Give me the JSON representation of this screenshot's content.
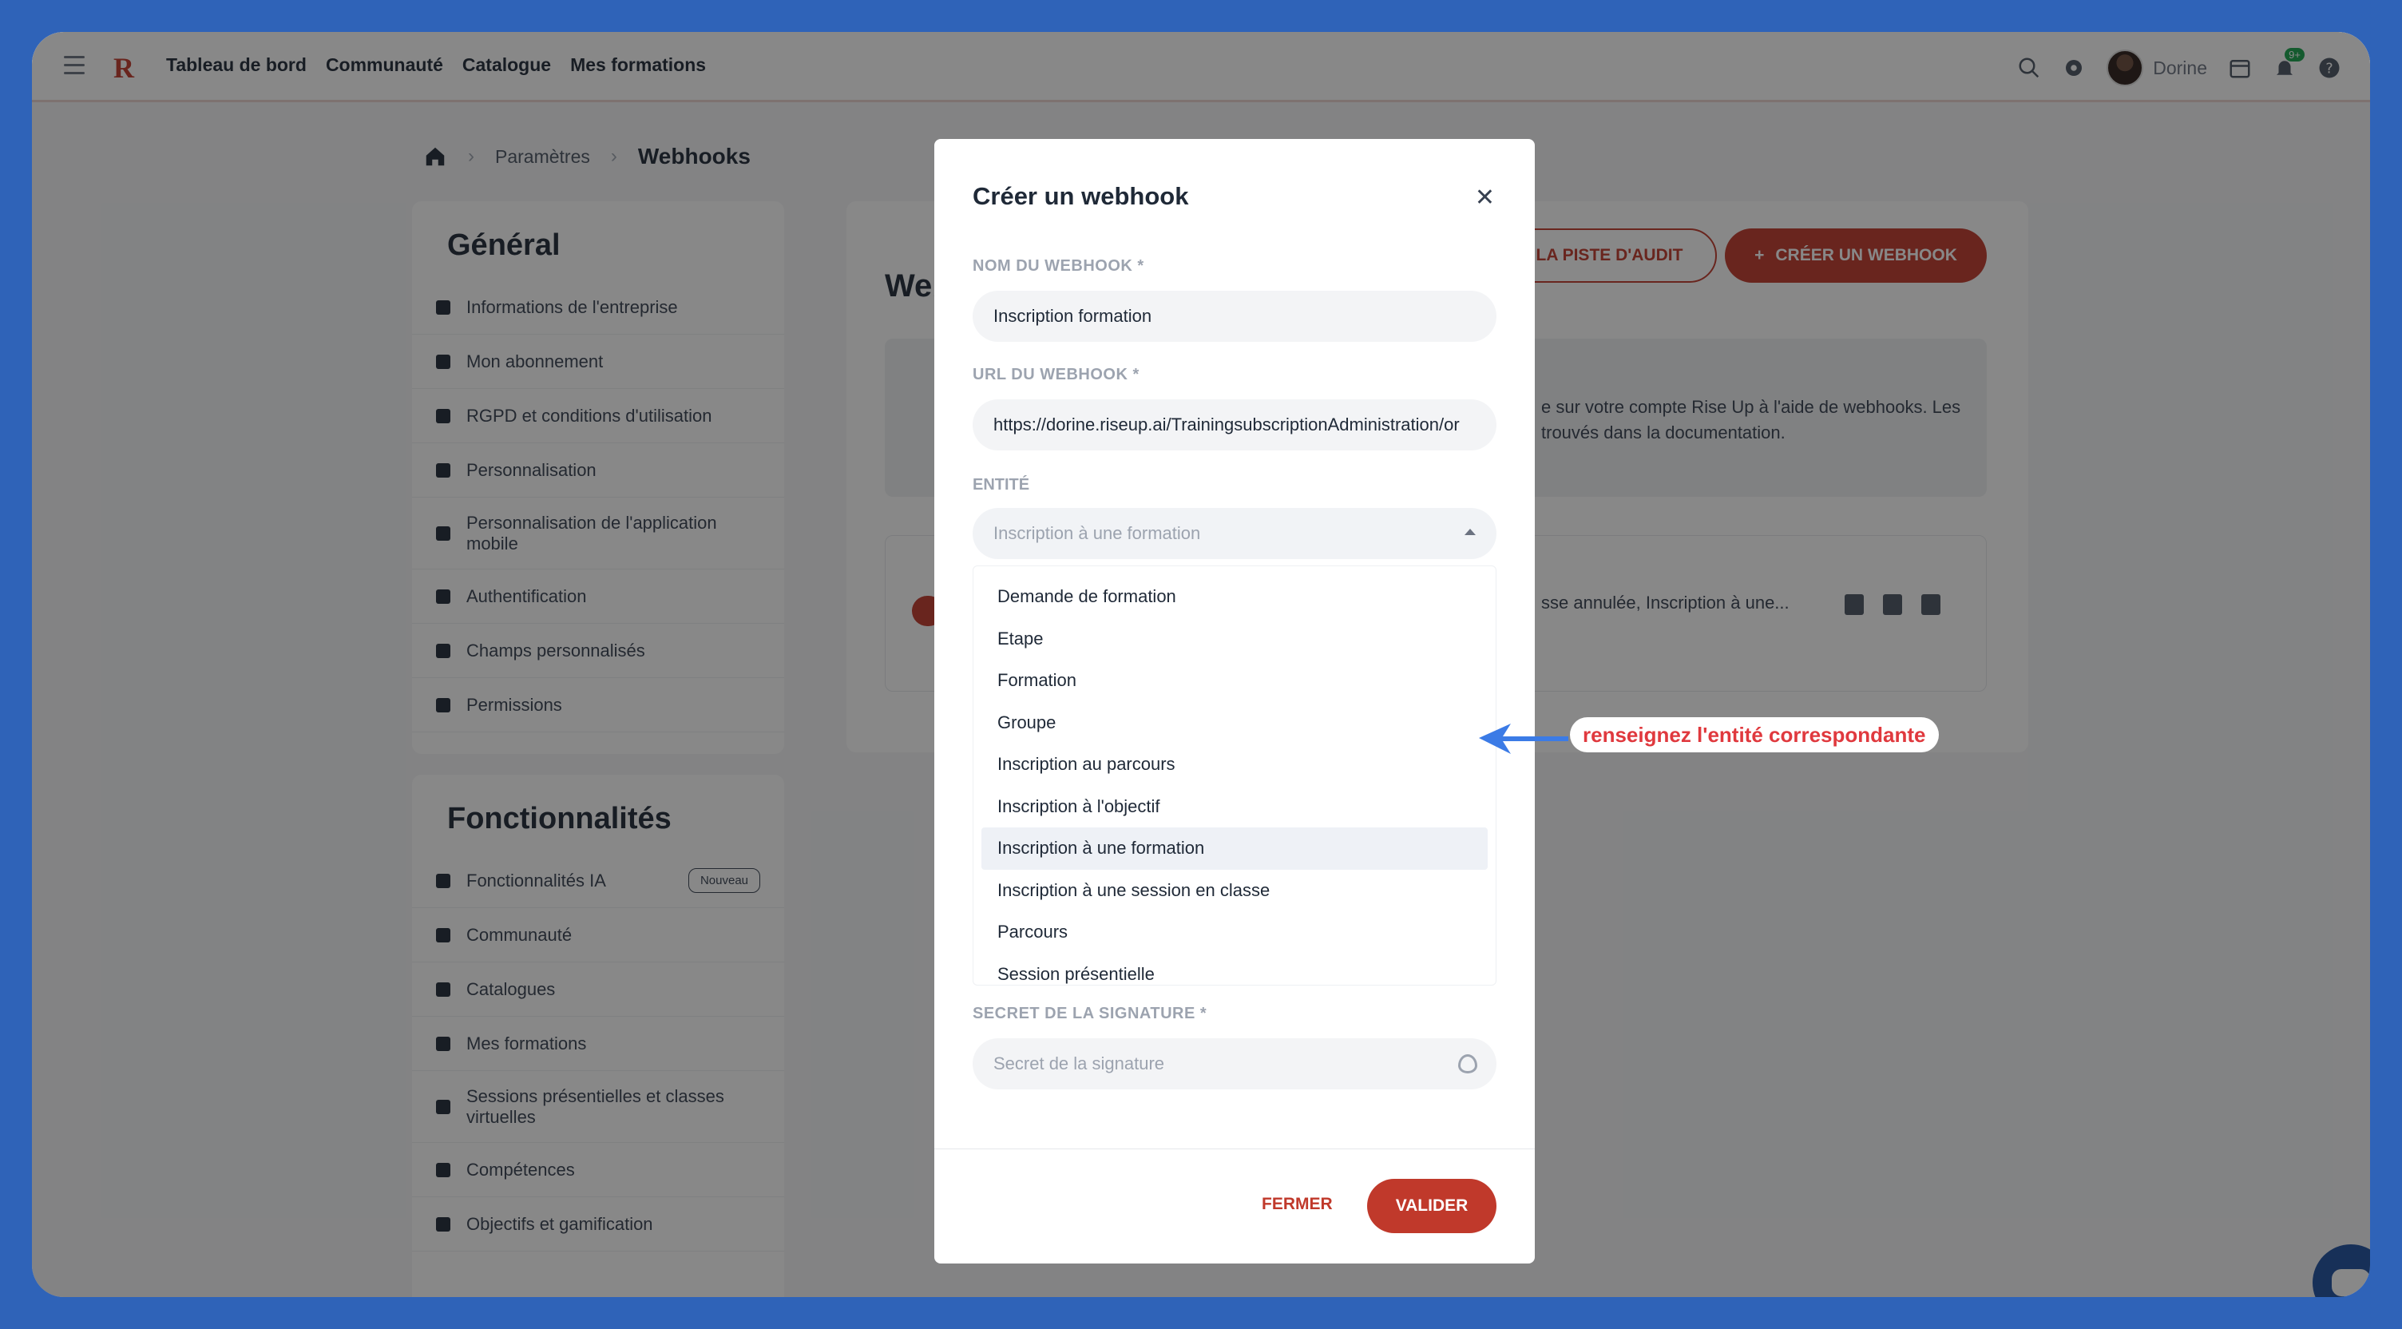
{
  "nav": {
    "logo": "R",
    "items": [
      "Tableau de bord",
      "Communauté",
      "Catalogue",
      "Mes formations"
    ],
    "user_name": "Dorine",
    "notif_badge": "9+"
  },
  "breadcrumb": {
    "items": [
      "Paramètres",
      "Webhooks"
    ]
  },
  "general": {
    "title": "Général",
    "items": [
      "Informations de l'entreprise",
      "Mon abonnement",
      "RGPD et conditions d'utilisation",
      "Personnalisation",
      "Personnalisation de l'application mobile",
      "Authentification",
      "Champs personnalisés",
      "Permissions"
    ]
  },
  "features": {
    "title": "Fonctionnalités",
    "badge_new": "Nouveau",
    "items": [
      "Fonctionnalités IA",
      "Communauté",
      "Catalogues",
      "Mes formations",
      "Sessions présentielles et classes virtuelles",
      "Compétences",
      "Objectifs et gamification"
    ]
  },
  "main": {
    "title_partial": "Web",
    "audit_button": "R LA PISTE D'AUDIT",
    "create_button": "CRÉER UN WEBHOOK",
    "info_text": "e sur votre compte Rise Up à l'aide de webhooks. Les trouvés dans la documentation.",
    "row_text": "sse annulée, Inscription à une..."
  },
  "modal": {
    "title": "Créer un webhook",
    "name_label": "NOM DU WEBHOOK *",
    "name_value": "Inscription formation",
    "url_label": "URL DU WEBHOOK *",
    "url_value": "https://dorine.riseup.ai/TrainingsubscriptionAdministration/or",
    "entity_label": "ENTITÉ",
    "entity_placeholder": "Inscription à une formation",
    "entity_options": [
      "Demande de formation",
      "Etape",
      "Formation",
      "Groupe",
      "Inscription au parcours",
      "Inscription à l'objectif",
      "Inscription à une formation",
      "Inscription à une session en classe",
      "Parcours",
      "Session présentielle"
    ],
    "entity_selected_index": 6,
    "secret_label": "SECRET DE LA SIGNATURE *",
    "secret_placeholder": "Secret de la signature",
    "close_button": "FERMER",
    "validate_button": "VALIDER"
  },
  "annotation": {
    "text": "renseignez l'entité correspondante",
    "color": "#e0393e",
    "arrow_color": "#3b7be6"
  }
}
